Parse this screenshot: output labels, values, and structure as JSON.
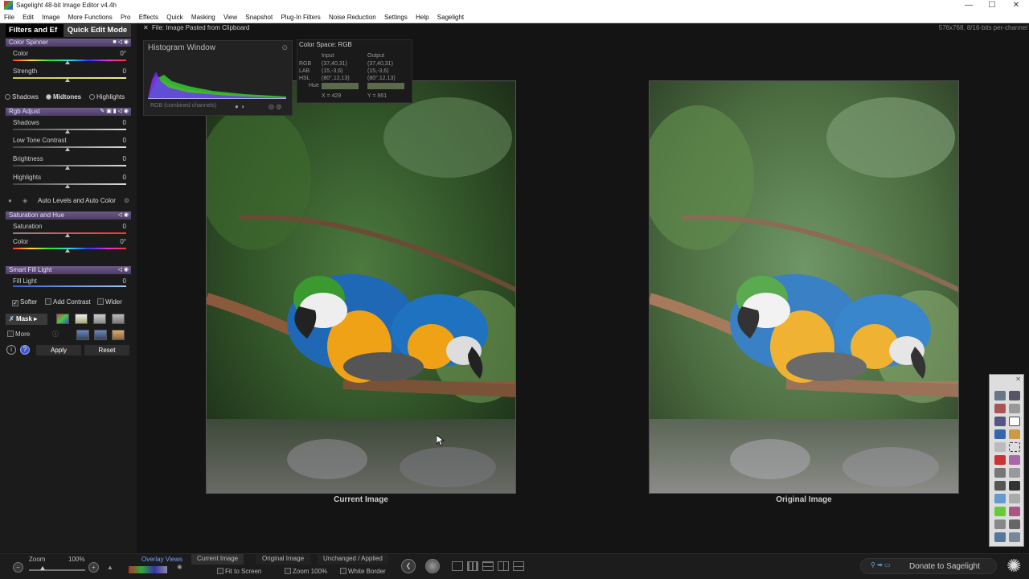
{
  "window": {
    "title": "Sagelight 48-bit Image Editor v4.4h",
    "minimize": "—",
    "maximize": "☐",
    "close": "✕"
  },
  "menu": [
    "File",
    "Edit",
    "Image",
    "More Functions",
    "Pro",
    "Effects",
    "Quick",
    "Masking",
    "View",
    "Snapshot",
    "Plug-In Filters",
    "Noise Reduction",
    "Settings",
    "Help",
    "Sagelight"
  ],
  "panel": {
    "tabs": {
      "filters": "Filters and Ef",
      "quick": "Quick Edit Mode"
    },
    "color_spinner": {
      "header": "Color Spinner",
      "color_label": "Color",
      "color_value": "0°",
      "strength_label": "Strength",
      "strength_value": "0"
    },
    "ranges": {
      "shadows": "Shadows",
      "midtones": "Midtones",
      "highlights": "Highlights",
      "selected": "Midtones"
    },
    "rgb_adjust": {
      "header": "Rgb Adjust",
      "shadows_label": "Shadows",
      "shadows_value": "0",
      "ltc_label": "Low Tone Contrast",
      "ltc_value": "0",
      "brightness_label": "Brightness",
      "brightness_value": "0",
      "highlights_label": "Highlights",
      "highlights_value": "0"
    },
    "auto_levels": "Auto Levels and Auto Color",
    "sat_hue": {
      "header": "Saturation and Hue",
      "saturation_label": "Saturation",
      "saturation_value": "0",
      "color_label": "Color",
      "color_value": "0°"
    },
    "smart_fill": {
      "header": "Smart Fill Light",
      "fill_label": "Fill Light",
      "fill_value": "0"
    },
    "options": {
      "softer": "Softer",
      "softer_checked": true,
      "add_contrast": "Add Contrast",
      "wider": "Wider"
    },
    "mask_label": "Mask",
    "more_label": "More",
    "apply": "Apply",
    "reset": "Reset"
  },
  "file_info": {
    "left": "File: Image Pasted from Clipboard",
    "right": "576x768, 8/16-bits per-channel"
  },
  "histogram": {
    "title": "Histogram Window",
    "caption": "RGB (combined channels)"
  },
  "color_space": {
    "header": "Color Space: RGB",
    "col_input": "Input",
    "col_output": "Output",
    "rows": [
      {
        "label": "RGB",
        "input": "(37,40,31)",
        "output": "(37,40,31)"
      },
      {
        "label": "LAB",
        "input": "(15,-3,6)",
        "output": "(15,-3,6)"
      },
      {
        "label": "HSL",
        "input": "(80°,12,13)",
        "output": "(80°,12,13)"
      }
    ],
    "hue_label": "Hue",
    "x_readout": "X = 429",
    "y_readout": "Y = 861"
  },
  "captions": {
    "current": "Current Image",
    "original": "Original Image"
  },
  "statusbar": {
    "zoom_label": "Zoom",
    "zoom_value": "100%",
    "overlay_views": "Overlay Views",
    "current_image": "Current Image",
    "original_image": "Original Image",
    "unchanged_applied": "Unchanged / Applied",
    "fit_to_screen": "Fit to Screen",
    "zoom_100": "Zoom 100%",
    "white_border": "White Border",
    "donate": "Donate to Sagelight"
  },
  "colors": {
    "accent_header": "#5a4a78",
    "background": "#141414",
    "panel": "#1b1b1b"
  }
}
